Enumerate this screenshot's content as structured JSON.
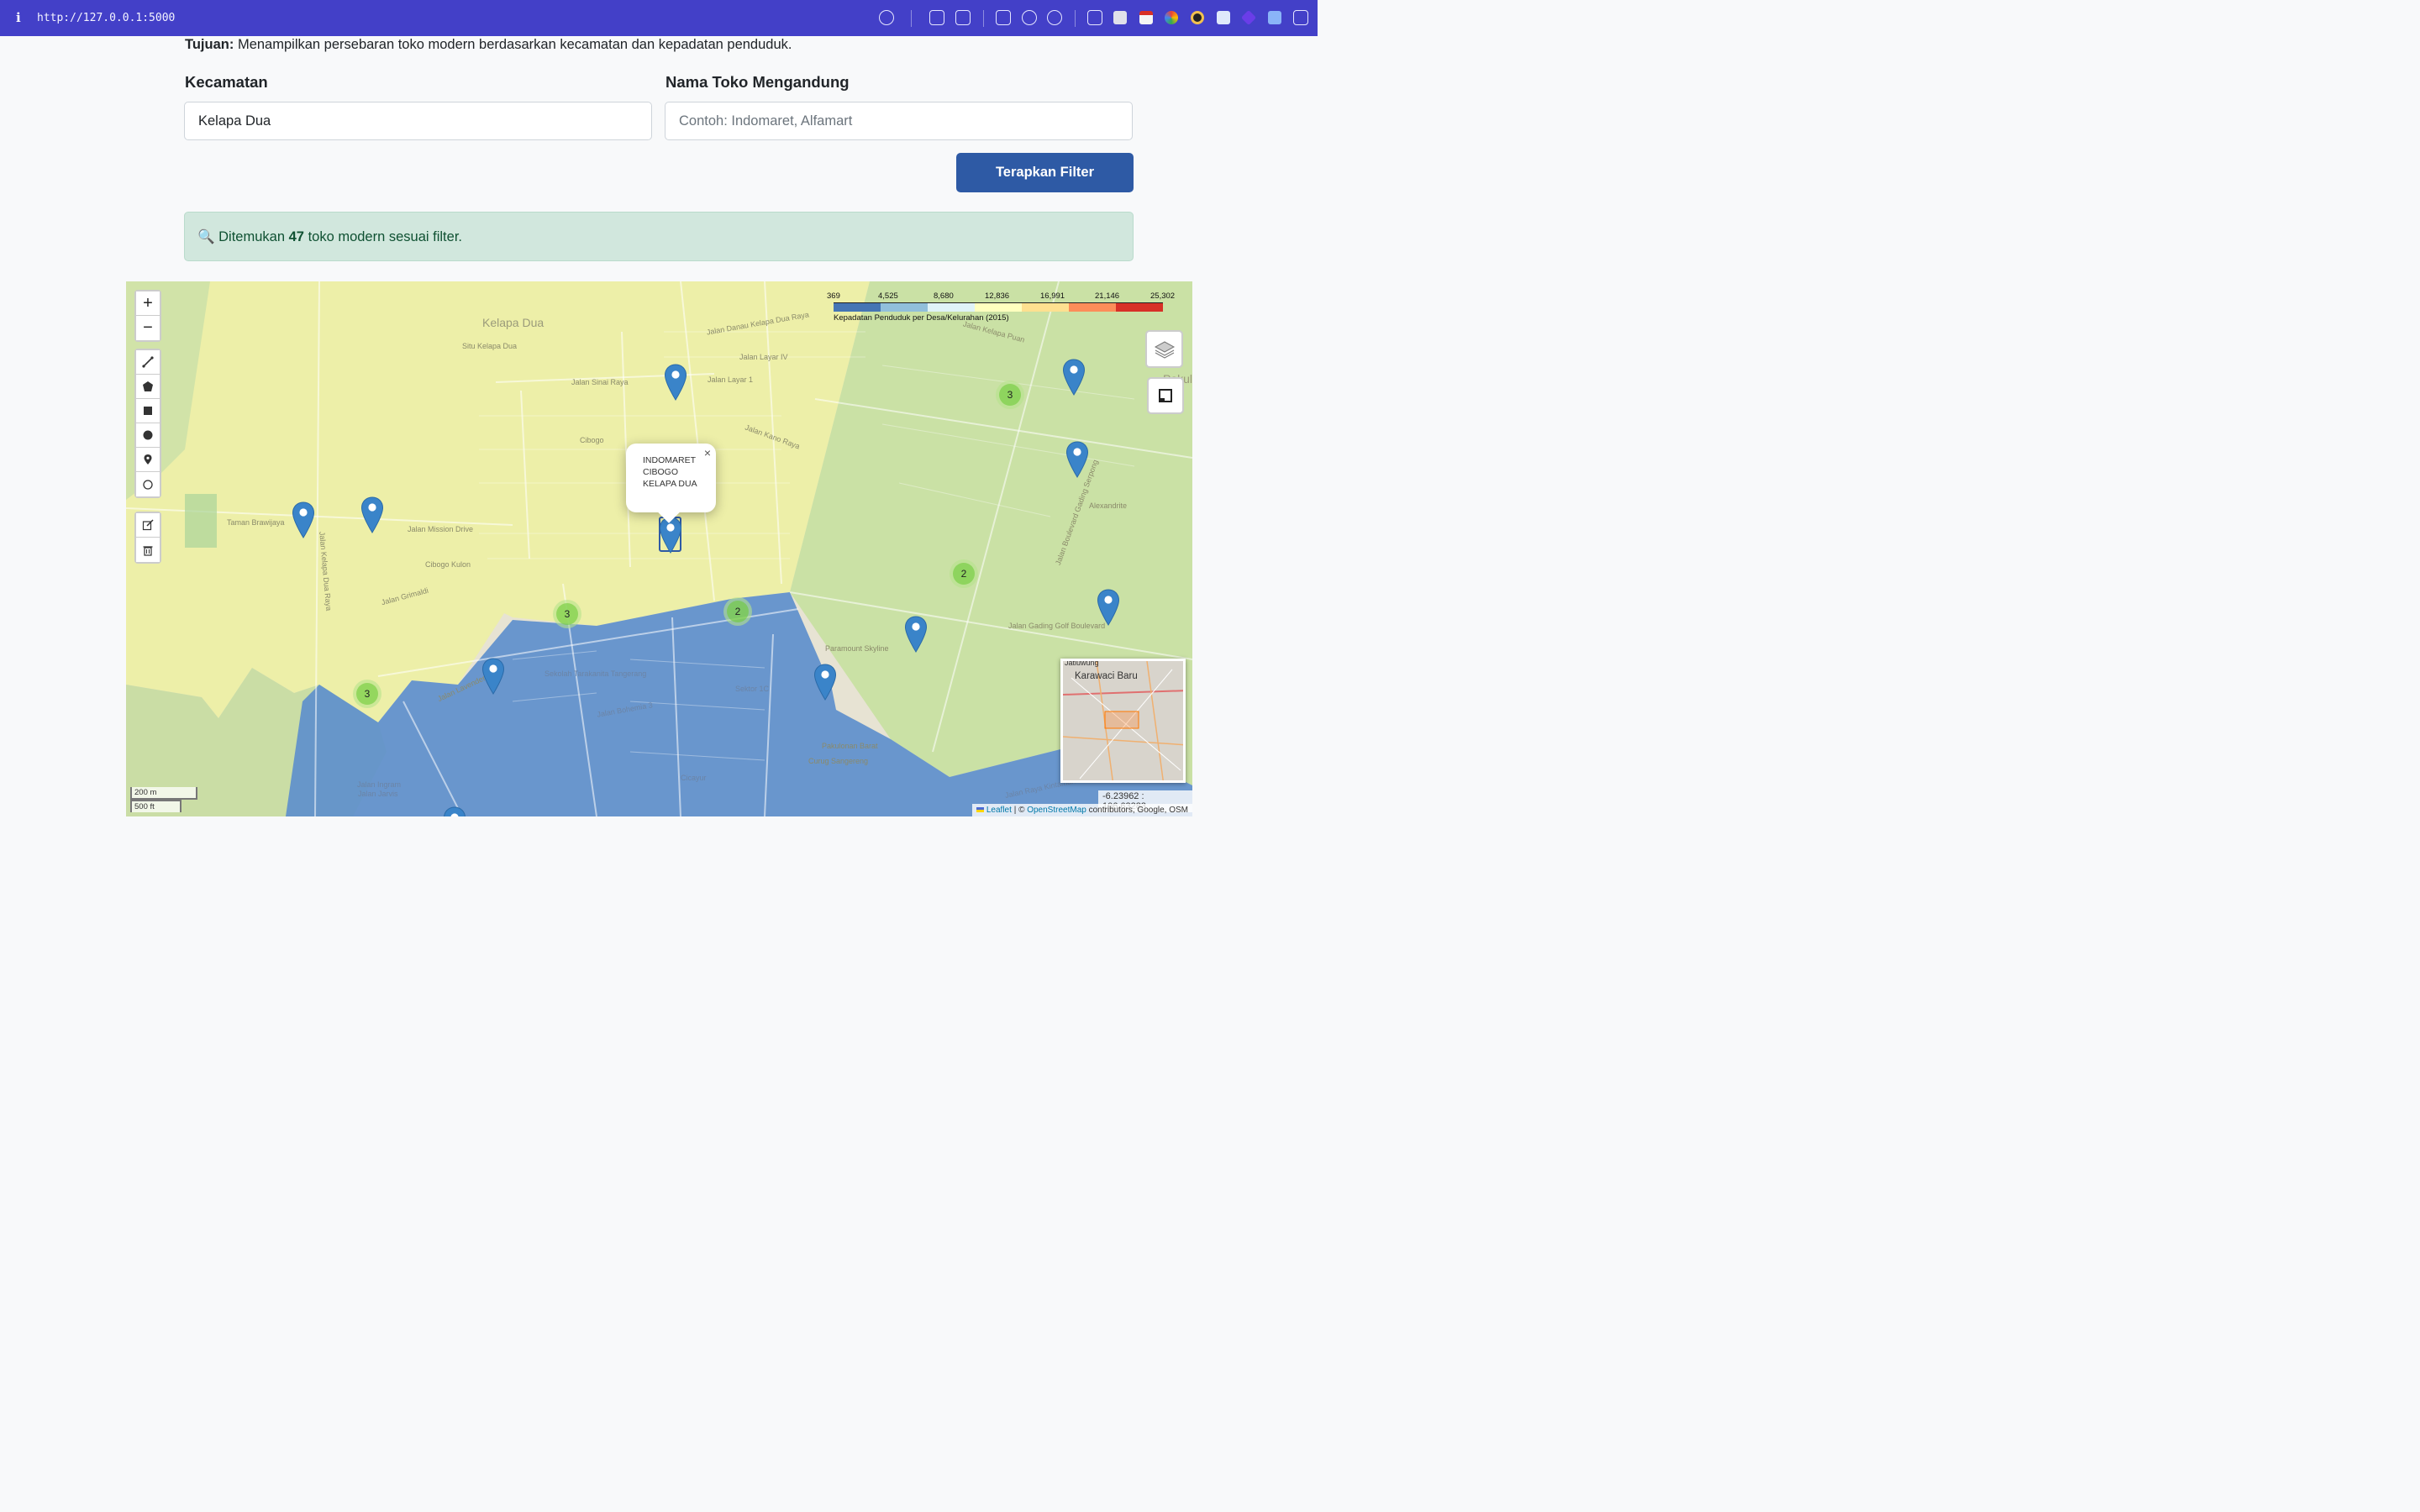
{
  "browser": {
    "url": "http://127.0.0.1:5000"
  },
  "page": {
    "purpose_label": "Tujuan:",
    "purpose_text": "Menampilkan persebaran toko modern berdasarkan kecamatan dan kepadatan penduduk."
  },
  "filters": {
    "district_label": "Kecamatan",
    "district_value": "Kelapa Dua",
    "store_label": "Nama Toko Mengandung",
    "store_placeholder": "Contoh: Indomaret, Alfamart",
    "apply_label": "Terapkan Filter"
  },
  "result": {
    "icon": "🔍",
    "prefix": "Ditemukan",
    "count": "47",
    "suffix": "toko modern sesuai filter."
  },
  "map": {
    "controls": {
      "zoom_in": "+",
      "zoom_out": "−"
    },
    "place_labels": [
      "Kelapa Dua",
      "Situ Kelapa Dua",
      "Cibogo",
      "Cibogo Kulon",
      "Taman Brawijaya",
      "Jalan Mission Drive",
      "Jalan Kelapa Dua Raya",
      "Jalan Danau Kelapa Dua Raya",
      "Jalan Sinai Raya",
      "Jalan Layar 1",
      "Jalan Layar IV",
      "Jalan Kano Raya",
      "Jalan Kelapa Puan",
      "Jalan Boulevard Gading Serpong",
      "Alexandrite",
      "Paramount Skyline",
      "Sekolah Tarakanita Tangerang",
      "Sektor 1C",
      "Pakulonan Barat",
      "Curug Sangereng",
      "Jalan Gading Golf Boulevard",
      "Jalan Jarvis",
      "Jalan Ingram",
      "Jalan Raya Kintamani Golf",
      "Pakulo Bar",
      "Jalan Bohemia 3",
      "Cicayur",
      "Jalan Lavender 1",
      "Jalan Grimaldi"
    ],
    "popup_text": "INDOMARET CIBOGO KELAPA DUA",
    "popup_close": "×",
    "clusters": [
      "3",
      "3",
      "2",
      "3",
      "3",
      "2"
    ],
    "legend": {
      "ticks": [
        "369",
        "4,525",
        "8,680",
        "12,836",
        "16,991",
        "21,146",
        "25,302"
      ],
      "colors": [
        "#4575b4",
        "#91bfdb",
        "#e0f3f8",
        "#ffffbf",
        "#fee090",
        "#fc8d59",
        "#d73027"
      ],
      "caption": "Kepadatan Penduduk per Desa/Kelurahan (2015)"
    },
    "minimap": {
      "top_label": "Jatiuwung",
      "title": "Karawaci Baru"
    },
    "scale": {
      "metric": "200 m",
      "imperial": "500 ft"
    },
    "coordinates": "-6.23962 : 106.63283",
    "attribution": {
      "leaflet": "Leaflet",
      "separator": "| ©",
      "osm": "OpenStreetMap",
      "rest": "contributors, Google, OSM"
    }
  }
}
